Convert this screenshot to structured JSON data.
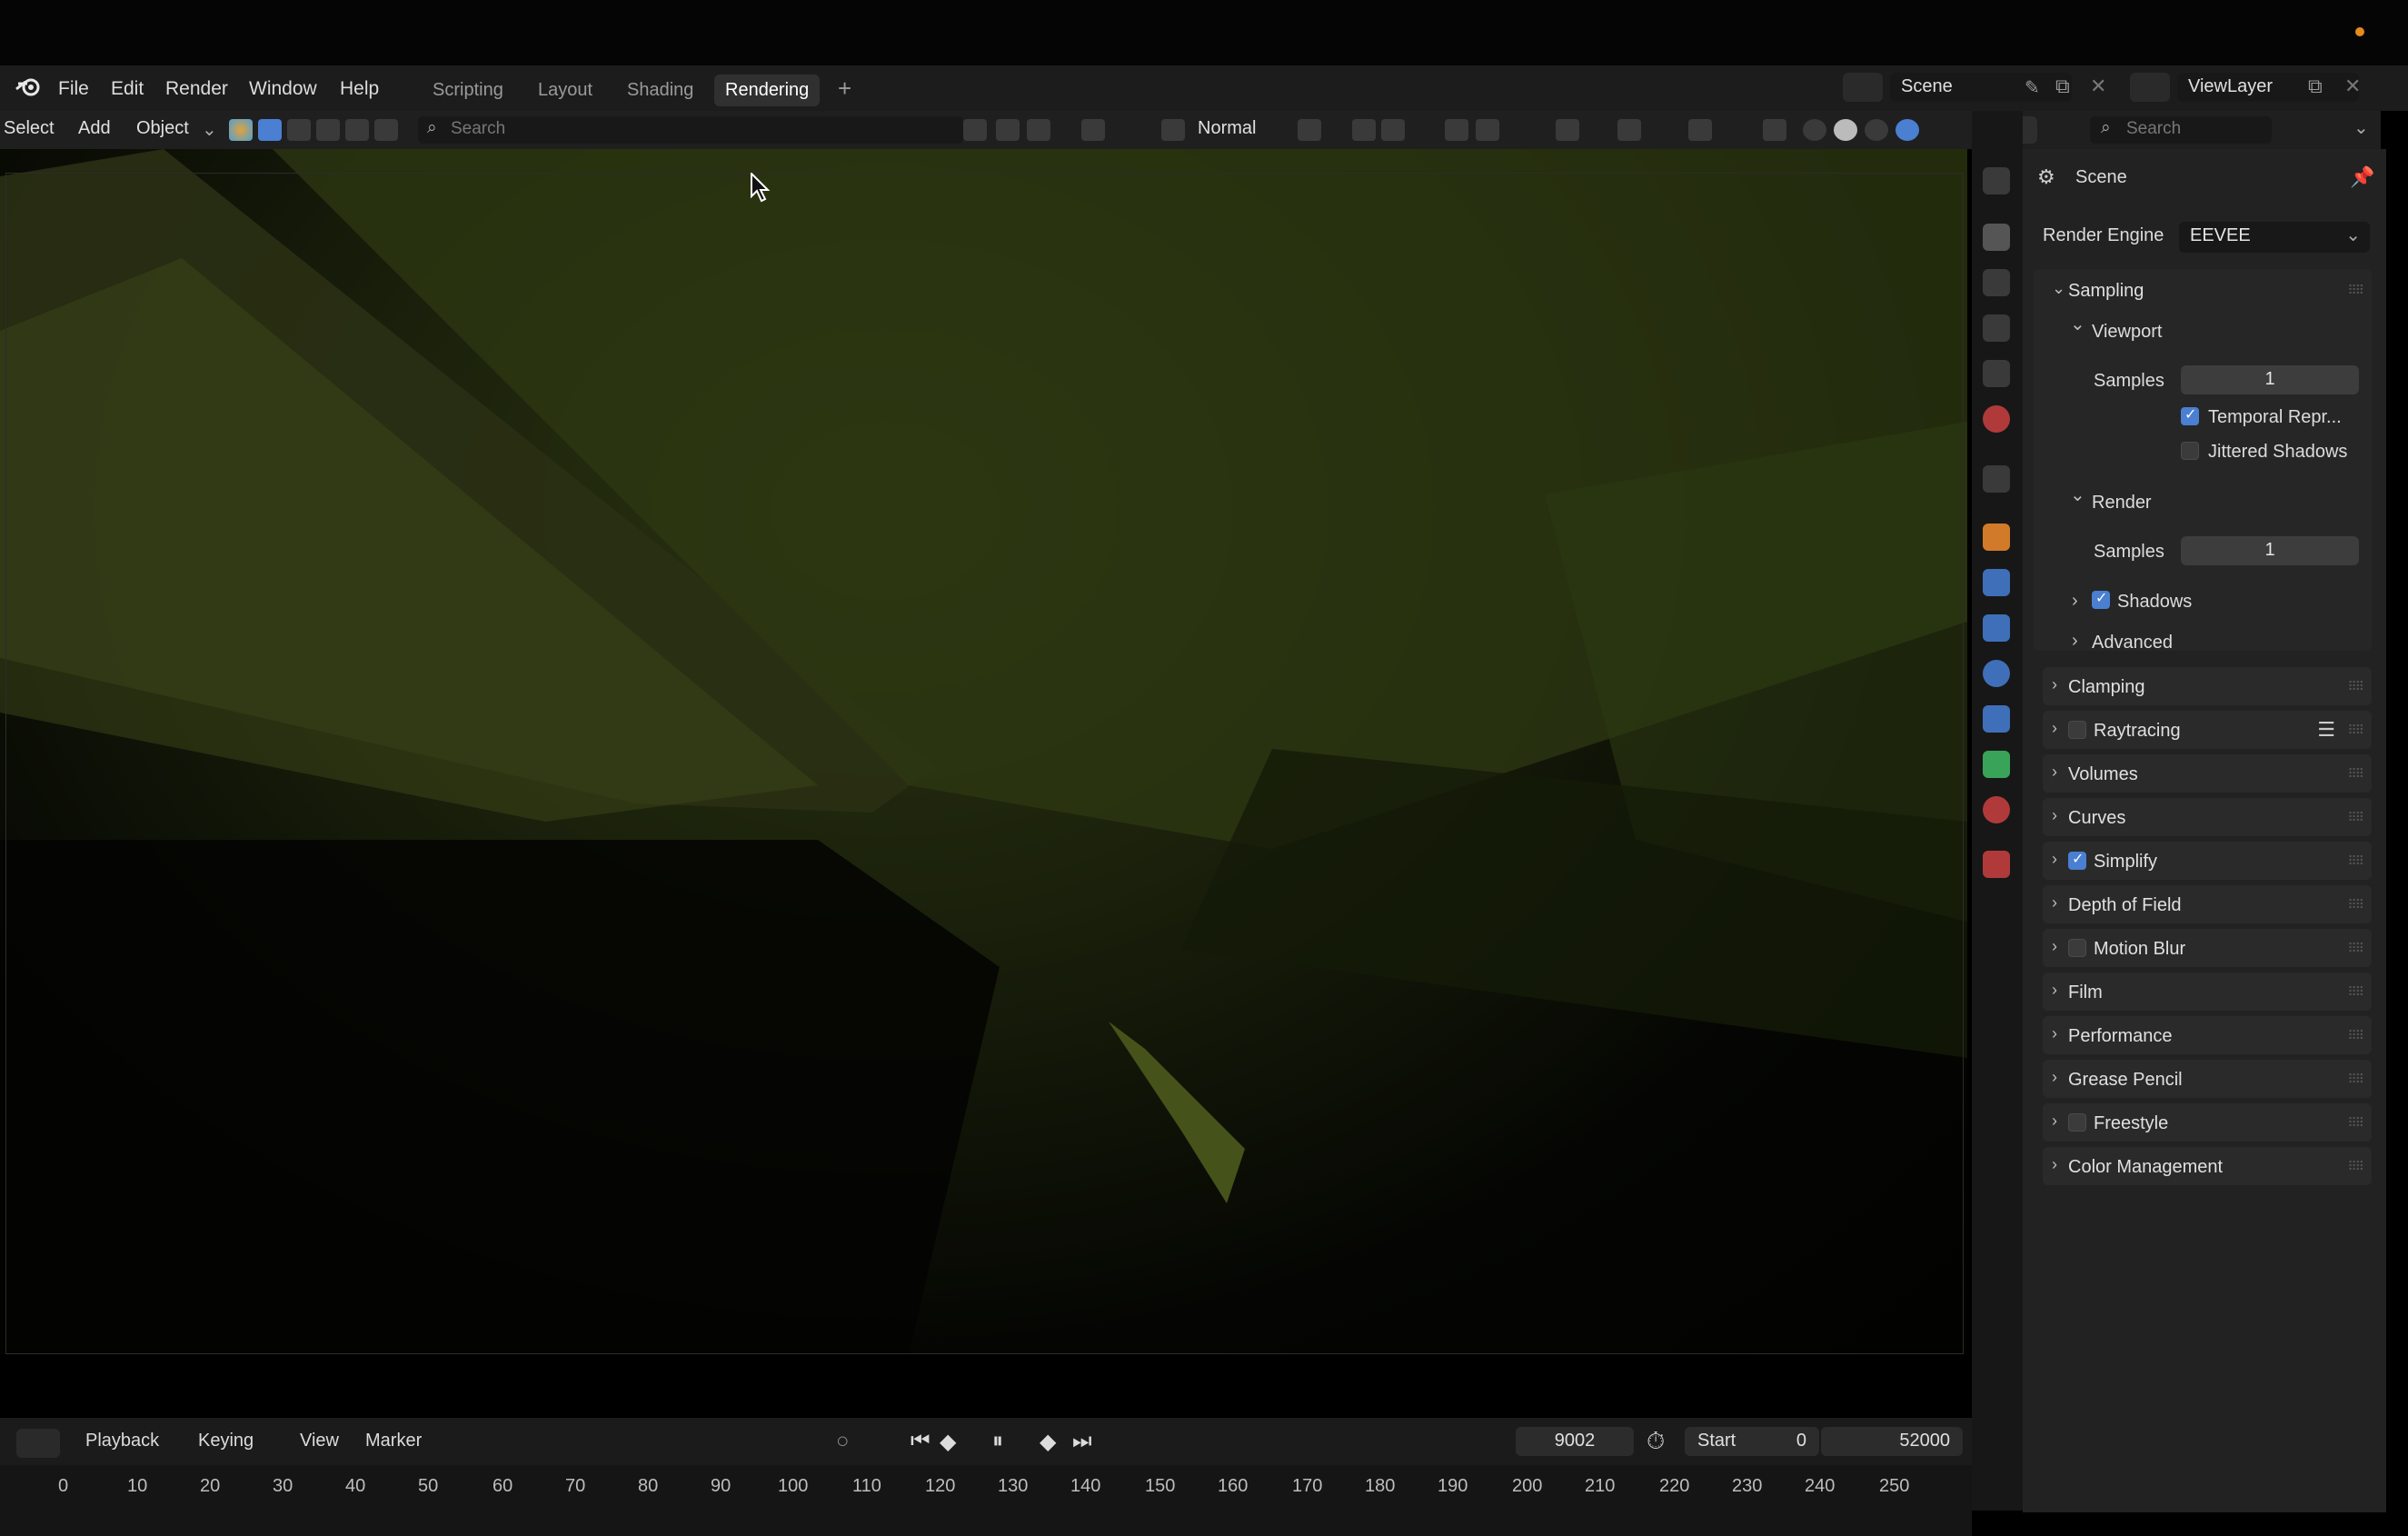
{
  "app": {
    "menus": [
      "File",
      "Edit",
      "Render",
      "Window",
      "Help"
    ],
    "workspace_tabs": [
      "Scripting",
      "Layout",
      "Shading",
      "Rendering"
    ],
    "active_tab": "Rendering",
    "add_tab": "+",
    "scene_name": "Scene",
    "view_layer": "ViewLayer"
  },
  "toolbar": {
    "select": "Select",
    "add": "Add",
    "object": "Object",
    "search_placeholder": "Search",
    "orientation": "Normal"
  },
  "properties": {
    "search_placeholder": "Search",
    "context": "Scene",
    "render_engine_label": "Render Engine",
    "render_engine": "EEVEE",
    "sampling": {
      "label": "Sampling",
      "viewport": "Viewport",
      "viewport_samples_label": "Samples",
      "viewport_samples": "1",
      "temporal": "Temporal Repr...",
      "temporal_checked": true,
      "jittered": "Jittered Shadows",
      "jittered_checked": false,
      "render": "Render",
      "render_samples_label": "Samples",
      "render_samples": "1",
      "shadows": "Shadows",
      "shadows_checked": true,
      "advanced": "Advanced"
    },
    "panels": [
      {
        "label": "Clamping",
        "checkbox": null
      },
      {
        "label": "Raytracing",
        "checkbox": false
      },
      {
        "label": "Volumes",
        "checkbox": null
      },
      {
        "label": "Curves",
        "checkbox": null
      },
      {
        "label": "Simplify",
        "checkbox": true
      },
      {
        "label": "Depth of Field",
        "checkbox": null
      },
      {
        "label": "Motion Blur",
        "checkbox": false
      },
      {
        "label": "Film",
        "checkbox": null
      },
      {
        "label": "Performance",
        "checkbox": null
      },
      {
        "label": "Grease Pencil",
        "checkbox": null
      },
      {
        "label": "Freestyle",
        "checkbox": false
      },
      {
        "label": "Color Management",
        "checkbox": null
      }
    ]
  },
  "timeline": {
    "playback": "Playback",
    "keying": "Keying",
    "view": "View",
    "marker": "Marker",
    "current_frame": "9002",
    "start_label": "Start",
    "start": "0",
    "end": "52000",
    "ruler": [
      "0",
      "10",
      "20",
      "30",
      "40",
      "50",
      "60",
      "70",
      "80",
      "90",
      "100",
      "110",
      "120",
      "130",
      "140",
      "150",
      "160",
      "170",
      "180",
      "190",
      "200",
      "210",
      "220",
      "230",
      "240",
      "250"
    ]
  },
  "colors": {
    "accent": "#4a7fd1",
    "status_dot": "#e68a1c"
  }
}
